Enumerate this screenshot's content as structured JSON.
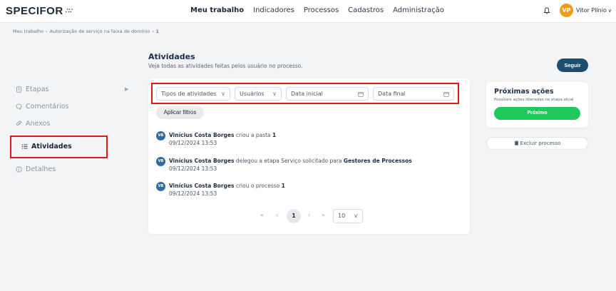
{
  "app": {
    "logo_text": "SPECIFOR",
    "logo_mark": "∴∵"
  },
  "nav": {
    "items": [
      {
        "label": "Meu trabalho",
        "active": true
      },
      {
        "label": "Indicadores",
        "active": false
      },
      {
        "label": "Processos",
        "active": false
      },
      {
        "label": "Cadastros",
        "active": false
      },
      {
        "label": "Administração",
        "active": false
      }
    ]
  },
  "user": {
    "initials": "VP",
    "name": "Vitor Plinio",
    "avatar_color": "#f39c12",
    "notification_icon": "bell-icon"
  },
  "breadcrumb": [
    "Meu trabalho",
    "Autorização de serviço na faixa de domínio",
    "1"
  ],
  "sidebar": {
    "items": [
      {
        "label": "Etapas",
        "icon": "document-icon",
        "active": false
      },
      {
        "label": "Comentários",
        "icon": "chat-icon",
        "active": false
      },
      {
        "label": "Anexos",
        "icon": "paperclip-icon",
        "active": false
      },
      {
        "label": "Atividades",
        "icon": "list-icon",
        "active": true
      },
      {
        "label": "Detalhes",
        "icon": "info-icon",
        "active": false
      }
    ]
  },
  "activities": {
    "title": "Atividades",
    "subtitle": "Veja todas as atividades feitas pelos usuário no processo.",
    "follow_button": "Seguir",
    "filters": {
      "type_placeholder": "Tipos de atividades",
      "users_placeholder": "Usuários",
      "start_date_placeholder": "Data inicial",
      "end_date_placeholder": "Data final",
      "apply_label": "Aplicar filtros"
    },
    "entries": [
      {
        "initials": "VB",
        "user": "Vinícius Costa Borges",
        "action": "criou a pasta",
        "target": "1",
        "date": "09/12/2024 13:53"
      },
      {
        "initials": "VB",
        "user": "Vinícius Costa Borges",
        "action": "delegou a etapa Serviço solicitado para",
        "target": "Gestores de Processos",
        "date": "09/12/2024 13:53"
      },
      {
        "initials": "VB",
        "user": "Vinícius Costa Borges",
        "action": "criou o processo",
        "target": "1",
        "date": "09/12/2024 13:53"
      }
    ],
    "pagination": {
      "first": "«",
      "prev": "‹",
      "current": "1",
      "next": "›",
      "last": "»",
      "page_size": "10"
    }
  },
  "actions_panel": {
    "title": "Próximas ações",
    "subtitle": "Possíveis ações liberadas na etapa atual",
    "next_button": "Próximo",
    "delete_button": "Excluir processo",
    "next_color": "#1ec85a"
  },
  "colors": {
    "accent": "#1d4e6e",
    "highlight": "#e01818"
  }
}
